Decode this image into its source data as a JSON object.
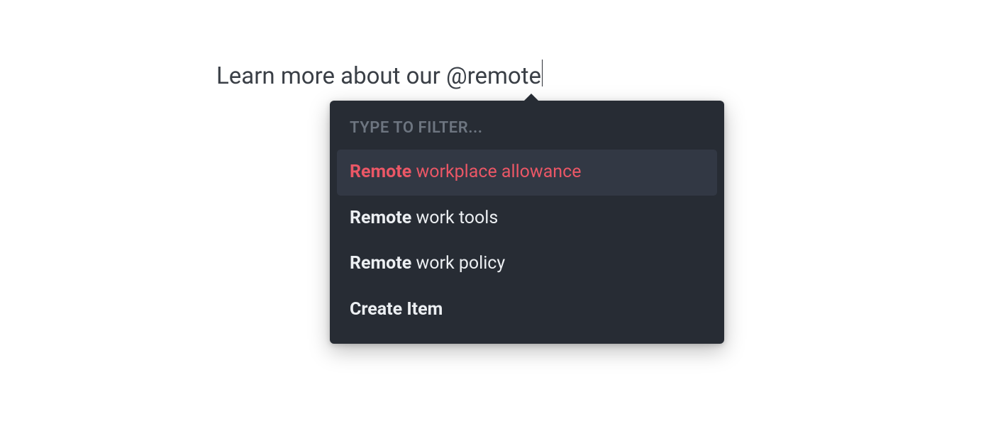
{
  "input": {
    "text": "Learn more about our @remote"
  },
  "popover": {
    "filter_label": "Type to filter...",
    "options": [
      {
        "match": "Remote",
        "rest": " workplace allowance",
        "selected": true
      },
      {
        "match": "Remote",
        "rest": " work tools",
        "selected": false
      },
      {
        "match": "Remote",
        "rest": " work policy",
        "selected": false
      }
    ],
    "create_label": "Create Item"
  }
}
